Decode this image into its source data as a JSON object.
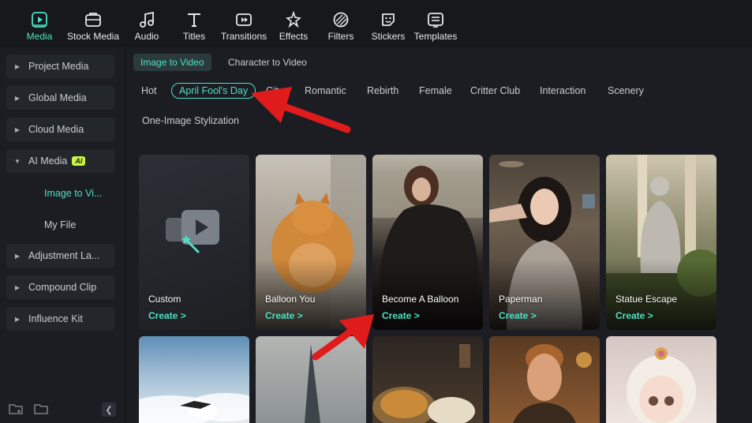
{
  "toolbar": {
    "items": [
      {
        "label": "Media",
        "icon": "media-icon",
        "active": true
      },
      {
        "label": "Stock Media",
        "icon": "stock-media-icon"
      },
      {
        "label": "Audio",
        "icon": "audio-icon"
      },
      {
        "label": "Titles",
        "icon": "titles-icon"
      },
      {
        "label": "Transitions",
        "icon": "transitions-icon"
      },
      {
        "label": "Effects",
        "icon": "effects-icon"
      },
      {
        "label": "Filters",
        "icon": "filters-icon"
      },
      {
        "label": "Stickers",
        "icon": "stickers-icon"
      },
      {
        "label": "Templates",
        "icon": "templates-icon"
      }
    ],
    "accent": "#4ee0c4"
  },
  "sidebar": {
    "items": [
      {
        "label": "Project Media"
      },
      {
        "label": "Global Media"
      },
      {
        "label": "Cloud Media"
      },
      {
        "label": "AI Media",
        "badge": "AI",
        "expanded": true
      },
      {
        "label": "Adjustment La..."
      },
      {
        "label": "Compound Clip"
      },
      {
        "label": "Influence Kit"
      }
    ],
    "subitems": [
      {
        "label": "Image to Vi...",
        "active": true
      },
      {
        "label": "My File"
      }
    ]
  },
  "main": {
    "mode_tabs": [
      {
        "label": "Image to Video",
        "active": true
      },
      {
        "label": "Character to Video"
      }
    ],
    "categories": [
      {
        "label": "Hot"
      },
      {
        "label": "April Fool's Day",
        "active": true
      },
      {
        "label": "City"
      },
      {
        "label": "Romantic"
      },
      {
        "label": "Rebirth"
      },
      {
        "label": "Female"
      },
      {
        "label": "Critter Club"
      },
      {
        "label": "Interaction"
      },
      {
        "label": "Scenery"
      },
      {
        "label": "One-Image Stylization"
      }
    ],
    "cards": [
      {
        "title": "Custom",
        "action": "Create >"
      },
      {
        "title": "Balloon You",
        "action": "Create >"
      },
      {
        "title": "Become A Balloon",
        "action": "Create >"
      },
      {
        "title": "Paperman",
        "action": "Create >"
      },
      {
        "title": "Statue Escape",
        "action": "Create >"
      }
    ]
  },
  "annotation_color": "#e01b1b"
}
